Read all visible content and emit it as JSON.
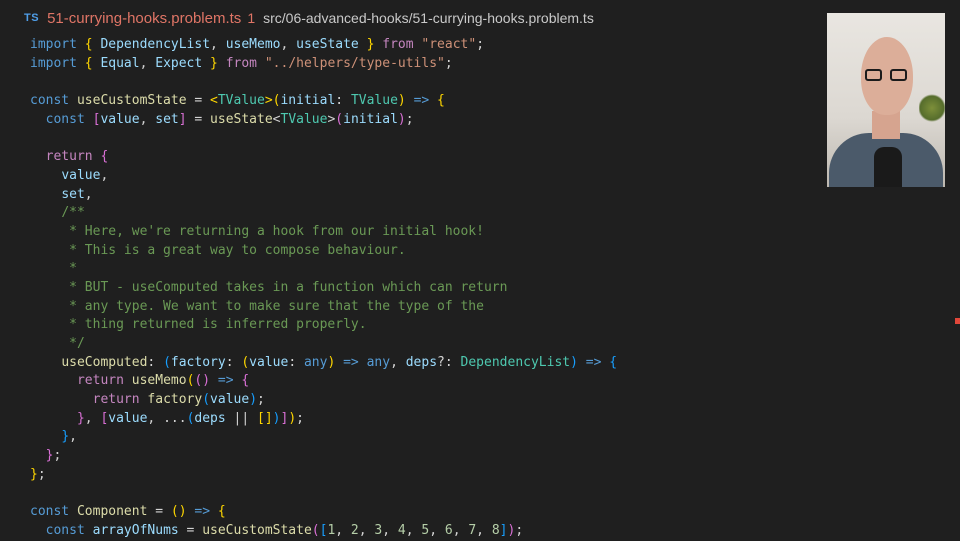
{
  "tab": {
    "lang_badge": "TS",
    "filename": "51-currying-hooks.problem.ts",
    "problem_count": "1",
    "path": "src/06-advanced-hooks/51-currying-hooks.problem.ts"
  },
  "colors": {
    "background": "#1f1f1f",
    "keyword": "#569cd6",
    "control": "#c586c0",
    "variable": "#9cdcfe",
    "function": "#dcdcaa",
    "string": "#ce9178",
    "type": "#4ec9b0",
    "comment": "#6a9955",
    "number": "#b5cea8",
    "error": "#e07566"
  },
  "code": [
    [
      [
        "kw",
        "import"
      ],
      [
        "pl",
        " "
      ],
      [
        "b1",
        "{"
      ],
      [
        "var",
        " DependencyList"
      ],
      [
        "pl",
        ", "
      ],
      [
        "var",
        "useMemo"
      ],
      [
        "pl",
        ", "
      ],
      [
        "var",
        "useState"
      ],
      [
        "pl",
        " "
      ],
      [
        "b1",
        "}"
      ],
      [
        "pl",
        " "
      ],
      [
        "ctl",
        "from"
      ],
      [
        "pl",
        " "
      ],
      [
        "str",
        "\"react\""
      ],
      [
        "pl",
        ";"
      ]
    ],
    [
      [
        "kw",
        "import"
      ],
      [
        "pl",
        " "
      ],
      [
        "b1",
        "{"
      ],
      [
        "var",
        " Equal"
      ],
      [
        "pl",
        ", "
      ],
      [
        "var",
        "Expect"
      ],
      [
        "pl",
        " "
      ],
      [
        "b1",
        "}"
      ],
      [
        "pl",
        " "
      ],
      [
        "ctl",
        "from"
      ],
      [
        "pl",
        " "
      ],
      [
        "str",
        "\"../helpers/type-utils\""
      ],
      [
        "pl",
        ";"
      ]
    ],
    [],
    [
      [
        "kw",
        "const"
      ],
      [
        "pl",
        " "
      ],
      [
        "fn",
        "useCustomState"
      ],
      [
        "pl",
        " = "
      ],
      [
        "b1",
        "<"
      ],
      [
        "type",
        "TValue"
      ],
      [
        "b1",
        ">"
      ],
      [
        "b1",
        "("
      ],
      [
        "var",
        "initial"
      ],
      [
        "pl",
        ": "
      ],
      [
        "type",
        "TValue"
      ],
      [
        "b1",
        ")"
      ],
      [
        "pl",
        " "
      ],
      [
        "kw",
        "=>"
      ],
      [
        "pl",
        " "
      ],
      [
        "b1",
        "{"
      ]
    ],
    [
      [
        "pl",
        "  "
      ],
      [
        "kw",
        "const"
      ],
      [
        "pl",
        " "
      ],
      [
        "b2",
        "["
      ],
      [
        "var",
        "value"
      ],
      [
        "pl",
        ", "
      ],
      [
        "var",
        "set"
      ],
      [
        "b2",
        "]"
      ],
      [
        "pl",
        " = "
      ],
      [
        "fn",
        "useState"
      ],
      [
        "pl",
        "<"
      ],
      [
        "type",
        "TValue"
      ],
      [
        "pl",
        ">"
      ],
      [
        "b2",
        "("
      ],
      [
        "var",
        "initial"
      ],
      [
        "b2",
        ")"
      ],
      [
        "pl",
        ";"
      ]
    ],
    [],
    [
      [
        "pl",
        "  "
      ],
      [
        "ctl",
        "return"
      ],
      [
        "pl",
        " "
      ],
      [
        "b2",
        "{"
      ]
    ],
    [
      [
        "pl",
        "    "
      ],
      [
        "var",
        "value"
      ],
      [
        "pl",
        ","
      ]
    ],
    [
      [
        "pl",
        "    "
      ],
      [
        "var",
        "set"
      ],
      [
        "pl",
        ","
      ]
    ],
    [
      [
        "pl",
        "    "
      ],
      [
        "cmt",
        "/**"
      ]
    ],
    [
      [
        "pl",
        "     "
      ],
      [
        "cmt",
        "* Here, we're returning a hook from our initial hook!"
      ]
    ],
    [
      [
        "pl",
        "     "
      ],
      [
        "cmt",
        "* This is a great way to compose behaviour."
      ]
    ],
    [
      [
        "pl",
        "     "
      ],
      [
        "cmt",
        "*"
      ]
    ],
    [
      [
        "pl",
        "     "
      ],
      [
        "cmt",
        "* BUT - useComputed takes in a function which can return"
      ]
    ],
    [
      [
        "pl",
        "     "
      ],
      [
        "cmt",
        "* any type. We want to make sure that the type of the"
      ]
    ],
    [
      [
        "pl",
        "     "
      ],
      [
        "cmt",
        "* thing returned is inferred properly."
      ]
    ],
    [
      [
        "pl",
        "     "
      ],
      [
        "cmt",
        "*/"
      ]
    ],
    [
      [
        "pl",
        "    "
      ],
      [
        "fn",
        "useComputed"
      ],
      [
        "pl",
        ": "
      ],
      [
        "b3",
        "("
      ],
      [
        "var",
        "factory"
      ],
      [
        "pl",
        ": "
      ],
      [
        "b1",
        "("
      ],
      [
        "var",
        "value"
      ],
      [
        "pl",
        ": "
      ],
      [
        "kw",
        "any"
      ],
      [
        "b1",
        ")"
      ],
      [
        "pl",
        " "
      ],
      [
        "kw",
        "=>"
      ],
      [
        "pl",
        " "
      ],
      [
        "kw",
        "any"
      ],
      [
        "pl",
        ", "
      ],
      [
        "var",
        "deps"
      ],
      [
        "pl",
        "?: "
      ],
      [
        "type",
        "DependencyList"
      ],
      [
        "b3",
        ")"
      ],
      [
        "pl",
        " "
      ],
      [
        "kw",
        "=>"
      ],
      [
        "pl",
        " "
      ],
      [
        "b3",
        "{"
      ]
    ],
    [
      [
        "pl",
        "      "
      ],
      [
        "ctl",
        "return"
      ],
      [
        "pl",
        " "
      ],
      [
        "fn",
        "useMemo"
      ],
      [
        "b1",
        "("
      ],
      [
        "b2",
        "("
      ],
      [
        "b2",
        ")"
      ],
      [
        "pl",
        " "
      ],
      [
        "kw",
        "=>"
      ],
      [
        "pl",
        " "
      ],
      [
        "b2",
        "{"
      ]
    ],
    [
      [
        "pl",
        "        "
      ],
      [
        "ctl",
        "return"
      ],
      [
        "pl",
        " "
      ],
      [
        "fn",
        "factory"
      ],
      [
        "b3",
        "("
      ],
      [
        "var",
        "value"
      ],
      [
        "b3",
        ")"
      ],
      [
        "pl",
        ";"
      ]
    ],
    [
      [
        "pl",
        "      "
      ],
      [
        "b2",
        "}"
      ],
      [
        "pl",
        ", "
      ],
      [
        "b2",
        "["
      ],
      [
        "var",
        "value"
      ],
      [
        "pl",
        ", ..."
      ],
      [
        "b3",
        "("
      ],
      [
        "var",
        "deps"
      ],
      [
        "pl",
        " || "
      ],
      [
        "b1",
        "[]"
      ],
      [
        "b3",
        ")"
      ],
      [
        "b2",
        "]"
      ],
      [
        "b1",
        ")"
      ],
      [
        "pl",
        ";"
      ]
    ],
    [
      [
        "pl",
        "    "
      ],
      [
        "b3",
        "}"
      ],
      [
        "pl",
        ","
      ]
    ],
    [
      [
        "pl",
        "  "
      ],
      [
        "b2",
        "}"
      ],
      [
        "pl",
        ";"
      ]
    ],
    [
      [
        "b1",
        "}"
      ],
      [
        "pl",
        ";"
      ]
    ],
    [],
    [
      [
        "kw",
        "const"
      ],
      [
        "pl",
        " "
      ],
      [
        "fn",
        "Component"
      ],
      [
        "pl",
        " = "
      ],
      [
        "b1",
        "("
      ],
      [
        "b1",
        ")"
      ],
      [
        "pl",
        " "
      ],
      [
        "kw",
        "=>"
      ],
      [
        "pl",
        " "
      ],
      [
        "b1",
        "{"
      ]
    ],
    [
      [
        "pl",
        "  "
      ],
      [
        "kw",
        "const"
      ],
      [
        "pl",
        " "
      ],
      [
        "var",
        "arrayOfNums"
      ],
      [
        "pl",
        " = "
      ],
      [
        "fn",
        "useCustomState"
      ],
      [
        "b2",
        "("
      ],
      [
        "b3",
        "["
      ],
      [
        "num",
        "1"
      ],
      [
        "pl",
        ", "
      ],
      [
        "num",
        "2"
      ],
      [
        "pl",
        ", "
      ],
      [
        "num",
        "3"
      ],
      [
        "pl",
        ", "
      ],
      [
        "num",
        "4"
      ],
      [
        "pl",
        ", "
      ],
      [
        "num",
        "5"
      ],
      [
        "pl",
        ", "
      ],
      [
        "num",
        "6"
      ],
      [
        "pl",
        ", "
      ],
      [
        "num",
        "7"
      ],
      [
        "pl",
        ", "
      ],
      [
        "num",
        "8"
      ],
      [
        "b3",
        "]"
      ],
      [
        "b2",
        ")"
      ],
      [
        "pl",
        ";"
      ]
    ]
  ]
}
